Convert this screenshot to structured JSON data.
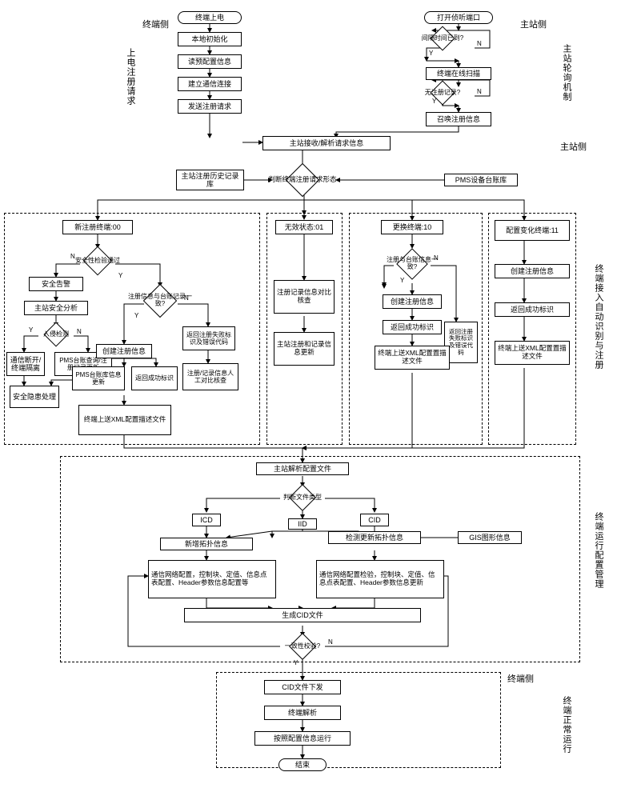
{
  "terminalSide": "终端侧",
  "masterSide": "主站侧",
  "powerOnReg": "上电注册请求",
  "masterPoll": "主站轮询机制",
  "terminalAutoId": "终端接入自动识别与注册",
  "terminalCfgMgmt": "终端运行配置管理",
  "terminalNormal": "终端正常运行",
  "t": {
    "powerOn": "终端上电",
    "localInit": "本地初始化",
    "readPreCfg": "读预配置信息",
    "establishComm": "建立通信连接",
    "sendRegReq": "发送注册请求",
    "openListen": "打开侦听端口",
    "intervalTime": "间隔时间已到?",
    "onlineScan": "终端在线扫描",
    "noRegRecord": "无注册记录?",
    "callRegInfo": "召唤注册信息",
    "masterRecv": "主站接收/解析请求信息",
    "masterHistLib": "主站注册历史记录库",
    "judgeRegForm": "判断终端注册请求形态",
    "pmsLedger": "PMS设备台账库",
    "newReg": "新注册终端:00",
    "invalid": "无效状态:01",
    "replace": "更换终端:10",
    "cfgChange": "配置变化终端:11",
    "secCheck": "安全性检验通过",
    "secAlarm": "安全告警",
    "masterSecAnly": "主站安全分析",
    "intrusion": "入侵检测",
    "commDisc": "通信断开/终端隔离",
    "secHidden": "安全隐患处理",
    "pmsQuery": "PMS台账查询/注册记录更新",
    "regInfoMatch": "注册信息与台账记录一致?",
    "createReg1": "创建注册信息",
    "pmsUpdate": "PMS台账库信息更新",
    "retSuccess1": "返回成功标识",
    "retFailCode1": "返回注册失败标识及错误代码",
    "regManual": "注册/记录信息人工对比核查",
    "uploadXml1": "终端上送XML配置描述文件",
    "regRecCompare": "注册记录信息对比核查",
    "masterRegUpdate": "主站注册和记录信息更新",
    "regLedgerMatch": "注册与台账信息一致?",
    "createReg2": "创建注册信息",
    "retSuccess2": "返回成功标识",
    "retFailCode2": "返回注册失败标识及错误代码",
    "uploadXml2": "终端上送XML配置置描述文件",
    "createReg3": "创建注册信息",
    "retSuccess3": "返回成功标识",
    "uploadXml3": "终端上送XML配置置描述文件",
    "parseConfig": "主站解析配置文件",
    "judgeFileType": "判断文件类型",
    "icd": "ICD",
    "iid": "IID",
    "cid": "CID",
    "gisInfo": "GIS图形信息",
    "addTopo": "新增拓扑信息",
    "checkTopo": "检测更新拓扑信息",
    "commCfg1": "通信网络配置，控制块、定值、信息点表配置、Header参数信息配置等",
    "commCfg2": "通信网络配置检验，控制块、定值、信息点表配置、Header参数信息更新",
    "genCid": "生成CID文件",
    "consistency": "一致性校验?",
    "cidDown": "CID文件下发",
    "termParse": "终端解析",
    "runByCfg": "按照配置信息运行",
    "end": "结束"
  },
  "yn": {
    "y": "Y",
    "n": "N"
  }
}
